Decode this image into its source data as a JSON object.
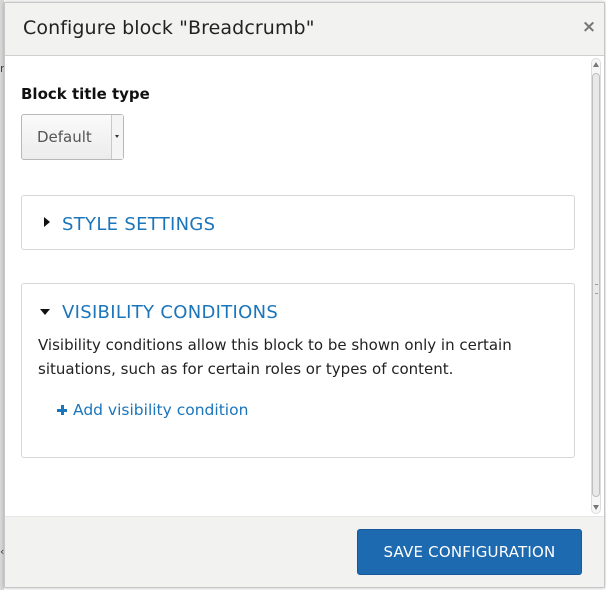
{
  "dialog": {
    "title": "Configure block \"Breadcrumb\"",
    "close_label": "×"
  },
  "form": {
    "block_title_type": {
      "label": "Block title type",
      "selected": "Default"
    }
  },
  "sections": {
    "style": {
      "label": "STYLE SETTINGS",
      "expanded": false
    },
    "visibility": {
      "label": "VISIBILITY CONDITIONS",
      "expanded": true,
      "description": "Visibility conditions allow this block to be shown only in certain situations, such as for certain roles or types of content.",
      "add_link": "Add visibility condition"
    }
  },
  "footer": {
    "save_label": "SAVE CONFIGURATION"
  },
  "icons": {
    "close": "close-icon",
    "collapsed": "triangle-right-icon",
    "expanded": "triangle-down-icon",
    "add": "plus-icon"
  },
  "colors": {
    "accent": "#1b75bb",
    "button": "#1e6ab0",
    "titlebar": "#f2f2f0"
  }
}
